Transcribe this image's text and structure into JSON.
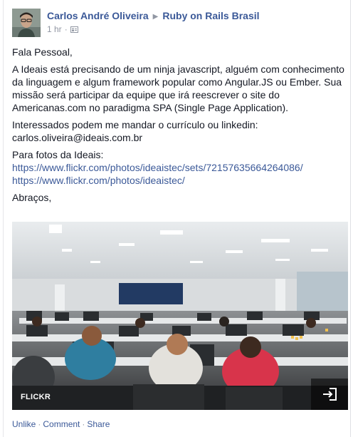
{
  "post": {
    "author": "Carlos André Oliveira",
    "group": "Ruby on Rails Brasil",
    "timestamp": "1 hr",
    "separator": "·",
    "audience_icon": "group-audience-icon",
    "paragraphs": {
      "greeting": "Fala Pessoal,",
      "body": "A Ideais está precisando de um ninja javascript, alguém com conhecimento da linguagem e algum framework popular como Angular.JS ou Ember. Sua missão será participar da equipe que irá reescrever o site do Americanas.com no paradigma SPA (Single Page Application).",
      "contact_intro": "Interessados podem me mandar o currículo ou linkedin:",
      "contact_email": "carlos.oliveira@ideais.com.br",
      "photos_intro": "Para fotos da Ideais:",
      "photos_link_1": "https://www.flickr.com/photos/ideaistec/sets/72157635664264086/",
      "photos_link_2": "https://www.flickr.com/photos/ideaistec/",
      "closing": "Abraços,"
    },
    "attachment": {
      "source": "FLICKR",
      "open_icon": "open-external-icon"
    },
    "actions": {
      "unlike": "Unlike",
      "comment": "Comment",
      "share": "Share",
      "separator": "·"
    }
  },
  "colors": {
    "link": "#3b5998",
    "text": "#141823",
    "meta": "#9197a3"
  }
}
